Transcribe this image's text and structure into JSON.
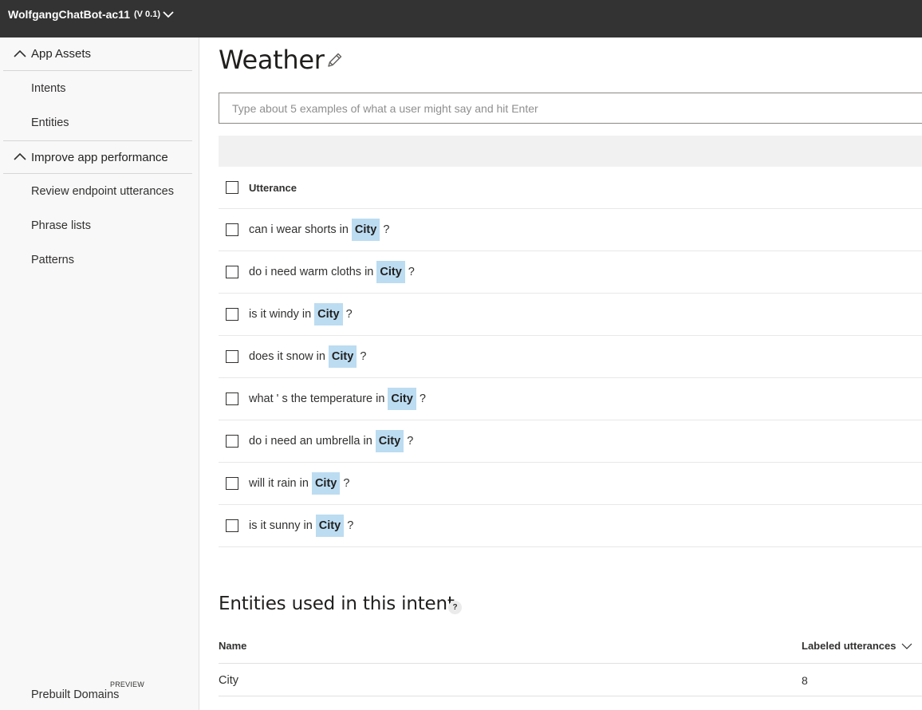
{
  "header": {
    "app_name": "WolfgangChatBot-ac11",
    "version": "(V 0.1)"
  },
  "sidebar": {
    "sections": [
      {
        "label": "App Assets",
        "items": [
          "Intents",
          "Entities"
        ]
      },
      {
        "label": "Improve app performance",
        "items": [
          "Review endpoint utterances",
          "Phrase lists",
          "Patterns"
        ]
      }
    ],
    "prebuilt_label": "Prebuilt Domains",
    "preview_badge": "PREVIEW"
  },
  "main": {
    "title": "Weather",
    "input_placeholder": "Type about 5 examples of what a user might say and hit Enter",
    "utterance_header": "Utterance",
    "utterances": [
      {
        "before": "can i wear shorts in",
        "entity": "City",
        "after": "?"
      },
      {
        "before": "do i need warm cloths in",
        "entity": "City",
        "after": "?"
      },
      {
        "before": "is it windy in",
        "entity": "City",
        "after": "?"
      },
      {
        "before": "does it snow in",
        "entity": "City",
        "after": "?"
      },
      {
        "before": "what ' s the temperature in",
        "entity": "City",
        "after": "?"
      },
      {
        "before": "do i need an umbrella in",
        "entity": "City",
        "after": "?"
      },
      {
        "before": "will it rain in",
        "entity": "City",
        "after": "?"
      },
      {
        "before": "is it sunny in",
        "entity": "City",
        "after": "?"
      }
    ],
    "entities_title": "Entities used in this intent",
    "help_glyph": "?",
    "entities_table": {
      "col_name": "Name",
      "col_count": "Labeled utterances",
      "rows": [
        {
          "name": "City",
          "count": "8"
        }
      ]
    }
  },
  "colors": {
    "topbar": "#333333",
    "sidebar_bg": "#f8f8f8",
    "entity_highlight": "#bcdcf1",
    "band": "#f1f1f1"
  }
}
